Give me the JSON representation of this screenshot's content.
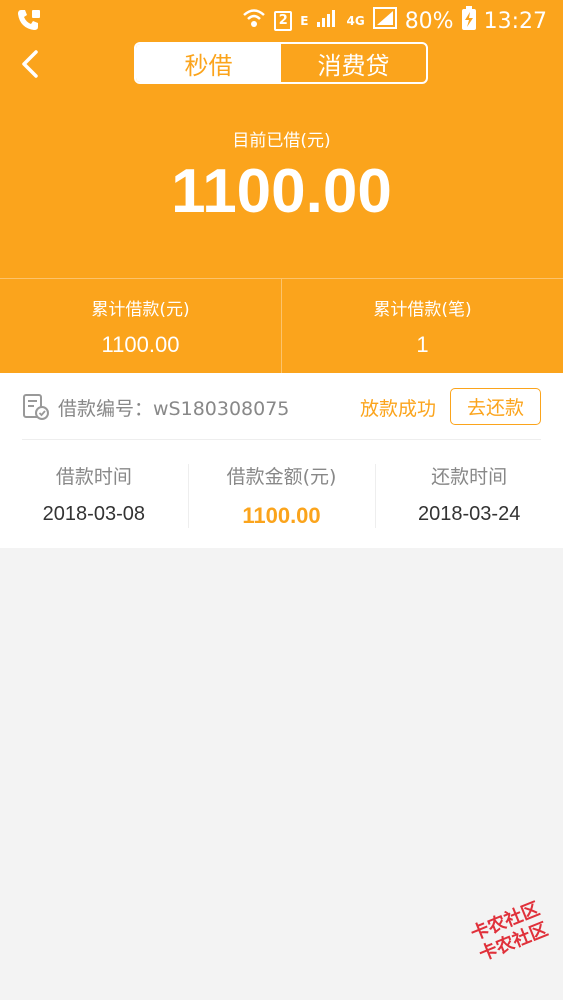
{
  "status_bar": {
    "network_e": "E",
    "network_4g": "4G",
    "sim": "2",
    "battery": "80%",
    "time": "13:27"
  },
  "header": {
    "tabs": [
      {
        "label": "秒借",
        "active": true
      },
      {
        "label": "消费贷",
        "active": false
      }
    ],
    "current_label": "目前已借(元)",
    "current_amount": "1100.00"
  },
  "stats": [
    {
      "label": "累计借款(元)",
      "value": "1100.00"
    },
    {
      "label": "累计借款(笔)",
      "value": "1"
    }
  ],
  "loan": {
    "number_label": "借款编号：wS180308075",
    "status": "放款成功",
    "repay_label": "去还款",
    "columns": [
      {
        "label": "借款时间",
        "value": "2018-03-08"
      },
      {
        "label": "借款金额(元)",
        "value": "1100.00"
      },
      {
        "label": "还款时间",
        "value": "2018-03-24"
      }
    ]
  },
  "watermark": {
    "line1": "卡农社区",
    "line2": "卡农社区"
  },
  "colors": {
    "accent": "#FBA41C",
    "background": "#F3F3F3",
    "card": "#FFFFFF"
  }
}
